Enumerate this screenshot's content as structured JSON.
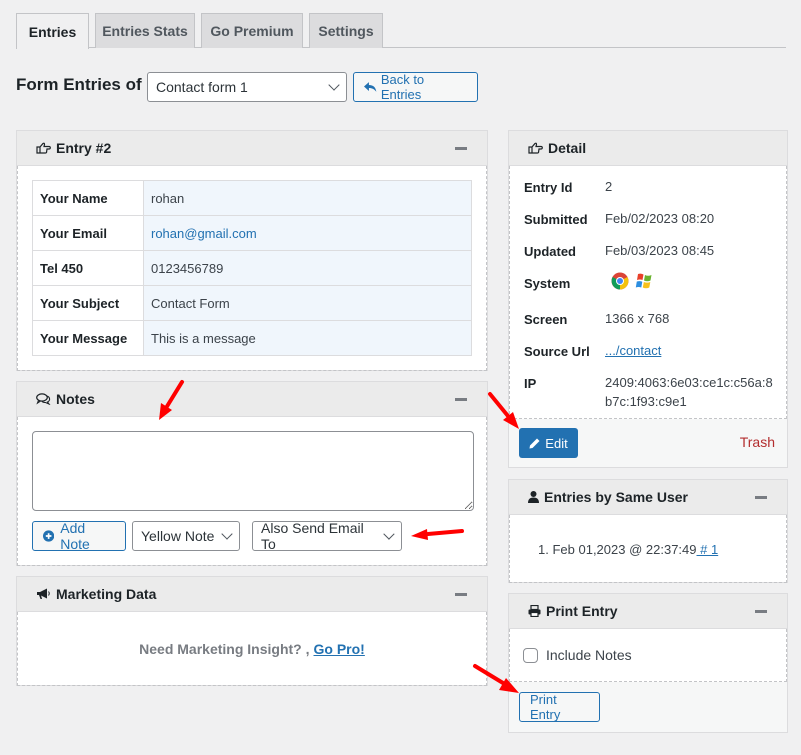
{
  "tabs": [
    {
      "label": "Entries",
      "active": true
    },
    {
      "label": "Entries Stats",
      "active": false
    },
    {
      "label": "Go Premium",
      "active": false
    },
    {
      "label": "Settings",
      "active": false
    }
  ],
  "form_selector": {
    "label": "Form Entries of",
    "selected": "Contact form 1",
    "back_button": "Back to Entries"
  },
  "entry_box": {
    "title": "Entry #2",
    "icon": "hand-point-right-icon",
    "fields": [
      {
        "label": "Your Name",
        "value": "rohan",
        "link": false
      },
      {
        "label": "Your Email",
        "value": "rohan@gmail.com",
        "link": true
      },
      {
        "label": "Tel 450",
        "value": "0123456789",
        "link": false
      },
      {
        "label": "Your Subject",
        "value": "Contact Form",
        "link": false
      },
      {
        "label": "Your Message",
        "value": "This is a message",
        "link": false
      }
    ]
  },
  "notes_box": {
    "title": "Notes",
    "icon": "comments-icon",
    "textarea_value": "",
    "add_note_button": "Add Note",
    "note_color_select": "Yellow Note",
    "email_select": "Also Send Email To"
  },
  "marketing_box": {
    "title": "Marketing Data",
    "icon": "bullhorn-icon",
    "message": "Need Marketing Insight? ,",
    "link": "Go Pro!"
  },
  "detail_box": {
    "title": "Detail",
    "icon": "hand-point-right-icon",
    "rows": {
      "entry_id": {
        "label": "Entry Id",
        "value": "2"
      },
      "submitted": {
        "label": "Submitted",
        "value": "Feb/02/2023 08:20"
      },
      "updated": {
        "label": "Updated",
        "value": "Feb/03/2023 08:45"
      },
      "system": {
        "label": "System",
        "icons": [
          "chrome-icon",
          "windows-icon"
        ]
      },
      "screen": {
        "label": "Screen",
        "value": "1366 x 768"
      },
      "source_url": {
        "label": "Source Url",
        "value": ".../contact"
      },
      "ip": {
        "label": "IP",
        "value": "2409:4063:6e03:ce1c:c56a:8b7c:1f93:c9e1"
      }
    },
    "edit_button": "Edit",
    "trash_link": "Trash"
  },
  "same_user_box": {
    "title": "Entries by Same User",
    "icon": "user-icon",
    "items": [
      {
        "index": "1.",
        "text": "Feb 01,2023 @ 22:37:49",
        "link": " # 1"
      }
    ]
  },
  "print_box": {
    "title": "Print Entry",
    "icon": "print-icon",
    "checkbox_label": "Include Notes",
    "checkbox_checked": false,
    "print_button": "Print Entry"
  },
  "colors": {
    "accent": "#2271b1",
    "trash": "#b32d2e",
    "annotation_arrow": "#ff0000"
  }
}
